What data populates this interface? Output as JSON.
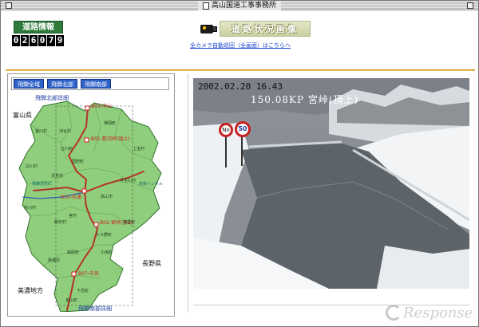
{
  "window": {
    "title": "高山国道工事事務所"
  },
  "header": {
    "road_info_label": "道路情報",
    "counter_digits": [
      "0",
      "2",
      "6",
      "0",
      "7",
      "9"
    ],
    "page_title": "道路状況画像",
    "all_camera_link": "全カメラ自動巡回（全画面）はこちらへ"
  },
  "sidebar": {
    "region_tabs": [
      "飛騨全域",
      "飛騨北部",
      "飛騨南部"
    ],
    "map": {
      "north_detail_label": "飛騨北部詳細",
      "south_detail_label": "飛騨南部詳細",
      "prefectures": {
        "toyama": "富山県",
        "nagano": "長野県",
        "mino": "美濃地方"
      },
      "cameras": [
        {
          "id": "B03",
          "name": "中山"
        },
        {
          "id": "B01",
          "name": "数河峠(頂上)"
        },
        {
          "id": "B10",
          "name": "石浦"
        },
        {
          "id": "B02",
          "name": "宮峠(頂上)"
        },
        {
          "id": "B07",
          "name": "中呂"
        }
      ],
      "places": [
        "宮川村",
        "河合村",
        "神岡町",
        "上宝村",
        "丹生川村",
        "高山市",
        "清見村",
        "飛騨清見IC",
        "安房トンネル",
        "荘川村",
        "朝日村",
        "久々野町",
        "高根村",
        "萩原町",
        "小坂町",
        "下呂町",
        "金山町",
        "馬瀬村",
        "白川村",
        "古川町",
        "国府町",
        "宮村"
      ]
    }
  },
  "camera": {
    "timestamp": "2002.02.20 16.43",
    "location": "150.08KP 宮峠(頂上)",
    "sign_no_entry": "No",
    "sign_speed": "50"
  },
  "watermark": {
    "text": "Response"
  }
}
